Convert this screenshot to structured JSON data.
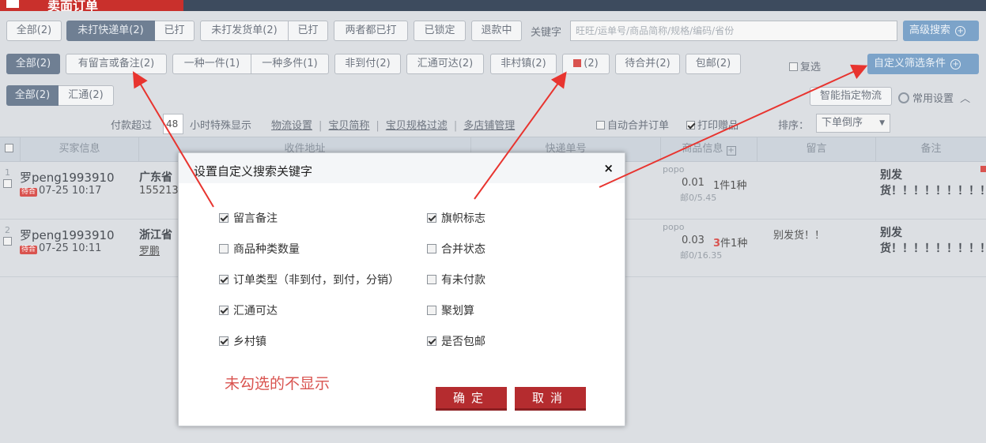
{
  "topbar": {
    "title": "卖面订单",
    "right": ""
  },
  "row1": {
    "all": "全部(2)",
    "unprinted_express": "未打快递单(2)",
    "printed1": "已打",
    "unprinted_delivery": "未打发货单(2)",
    "printed2": "已打",
    "both_printed": "两者都已打",
    "locked": "已锁定",
    "refunding": "退款中",
    "keyword_label": "关键字",
    "keyword_placeholder": "旺旺/运单号/商品简称/规格/编码/省份",
    "advanced_search": "高级搜索"
  },
  "row2": {
    "all": "全部(2)",
    "has_note": "有留言或备注(2)",
    "one_kind_one": "一种一件(1)",
    "one_kind_many": "一种多件(1)",
    "non_cod": "非到付(2)",
    "huitong": "汇通可达(2)",
    "non_village": "非村镇(2)",
    "flag_count": "(2)",
    "pending_merge": "待合并(2)",
    "free_ship": "包邮(2)",
    "multi_select": "复选",
    "custom_filter": "自定义筛选条件"
  },
  "row3": {
    "all": "全部(2)",
    "huitong": "汇通(2)",
    "smart_logistics": "智能指定物流",
    "common_settings": "常用设置"
  },
  "settings": {
    "pay_over_label": "付款超过",
    "hours_value": "48",
    "hours_suffix": "小时特殊显示",
    "logistics_setting": "物流设置",
    "item_short": "宝贝简称",
    "spec_filter": "宝贝规格过滤",
    "multi_shop": "多店铺管理",
    "auto_merge": "自动合并订单",
    "print_gift": "打印赠品",
    "sort_label": "排序：",
    "sort_value": "下单倒序"
  },
  "table": {
    "headers": [
      "买家信息",
      "收件地址",
      "快递单号",
      "商品信息",
      "留言",
      "备注"
    ],
    "rows": [
      {
        "index": "1",
        "buyer": "罗peng1993910",
        "tag": "待合",
        "date": "07-25 10:17",
        "province": "广东省",
        "sub": "155213",
        "product_code": "popo",
        "price": "0.01",
        "qty_prefix": "",
        "qty": "1件1种",
        "shipping": "邮0/5.45",
        "message": "",
        "remark": "别发货！！！！！！！！！！！！！..."
      },
      {
        "index": "2",
        "buyer": "罗peng1993910",
        "tag": "待合",
        "date": "07-25 10:11",
        "province": "浙江省",
        "sub": "罗鹏",
        "product_code": "popo",
        "price": "0.03",
        "qty_prefix": "3",
        "qty": "件1种",
        "shipping": "邮0/16.35",
        "message": "别发货！！",
        "remark": "别发货！！！！！！！！！！！！！..."
      }
    ]
  },
  "modal": {
    "title": "设置自定义搜索关键字",
    "close": "×",
    "options_left": [
      {
        "label": "留言备注",
        "checked": true
      },
      {
        "label": "商品种类数量",
        "checked": false
      },
      {
        "label": "订单类型（非到付，到付，分销）",
        "checked": true
      },
      {
        "label": "汇通可达",
        "checked": true
      },
      {
        "label": "乡村镇",
        "checked": true
      }
    ],
    "options_right": [
      {
        "label": "旗帜标志",
        "checked": true
      },
      {
        "label": "合并状态",
        "checked": false
      },
      {
        "label": "有未付款",
        "checked": false
      },
      {
        "label": "聚划算",
        "checked": false
      },
      {
        "label": "是否包邮",
        "checked": true
      }
    ],
    "note": "未勾选的不显示",
    "confirm": "确定",
    "cancel": "取消"
  },
  "colors": {
    "accent_red": "#d9534f",
    "button_red": "#b52c2f",
    "selected_gray": "#6f7f93",
    "blue_button": "#7ca3c9",
    "arrow_red": "#e8342f"
  }
}
